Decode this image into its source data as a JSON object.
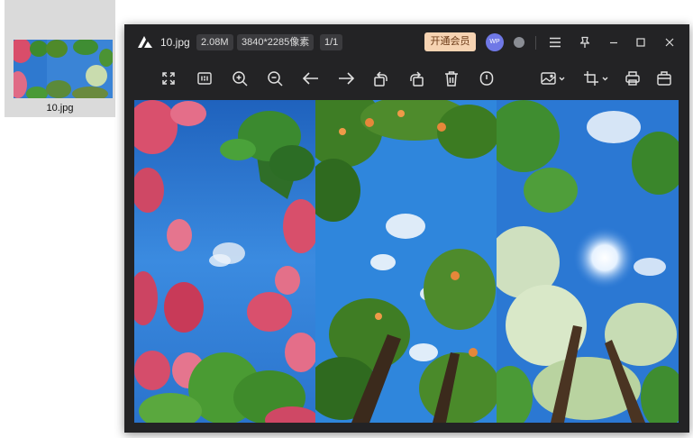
{
  "desktop": {
    "thumbnail_label": "10.jpg"
  },
  "window": {
    "filename": "10.jpg",
    "file_size": "2.08M",
    "resolution": "3840*2285像素",
    "page_count": "1/1",
    "vip_button": "开通会员",
    "avatar_text": "WP"
  },
  "icons": {
    "titlebar": [
      "app-logo-icon",
      "user-avatar",
      "member-badge-icon",
      "menu-icon",
      "pin-icon",
      "minimize-icon",
      "maximize-icon",
      "close-icon"
    ],
    "toolbar": [
      "fullscreen-icon",
      "actual-size-icon",
      "zoom-in-icon",
      "zoom-out-icon",
      "previous-arrow-icon",
      "next-arrow-icon",
      "rotate-left-icon",
      "rotate-right-icon",
      "delete-icon",
      "info-icon",
      "edit-image-icon",
      "crop-icon",
      "print-icon",
      "more-tools-icon"
    ]
  },
  "colors": {
    "window_bg": "#232325",
    "vip_bg": "#f6d3b2",
    "avatar_bg": "#6f78e6",
    "sky": "#2a72c8"
  }
}
